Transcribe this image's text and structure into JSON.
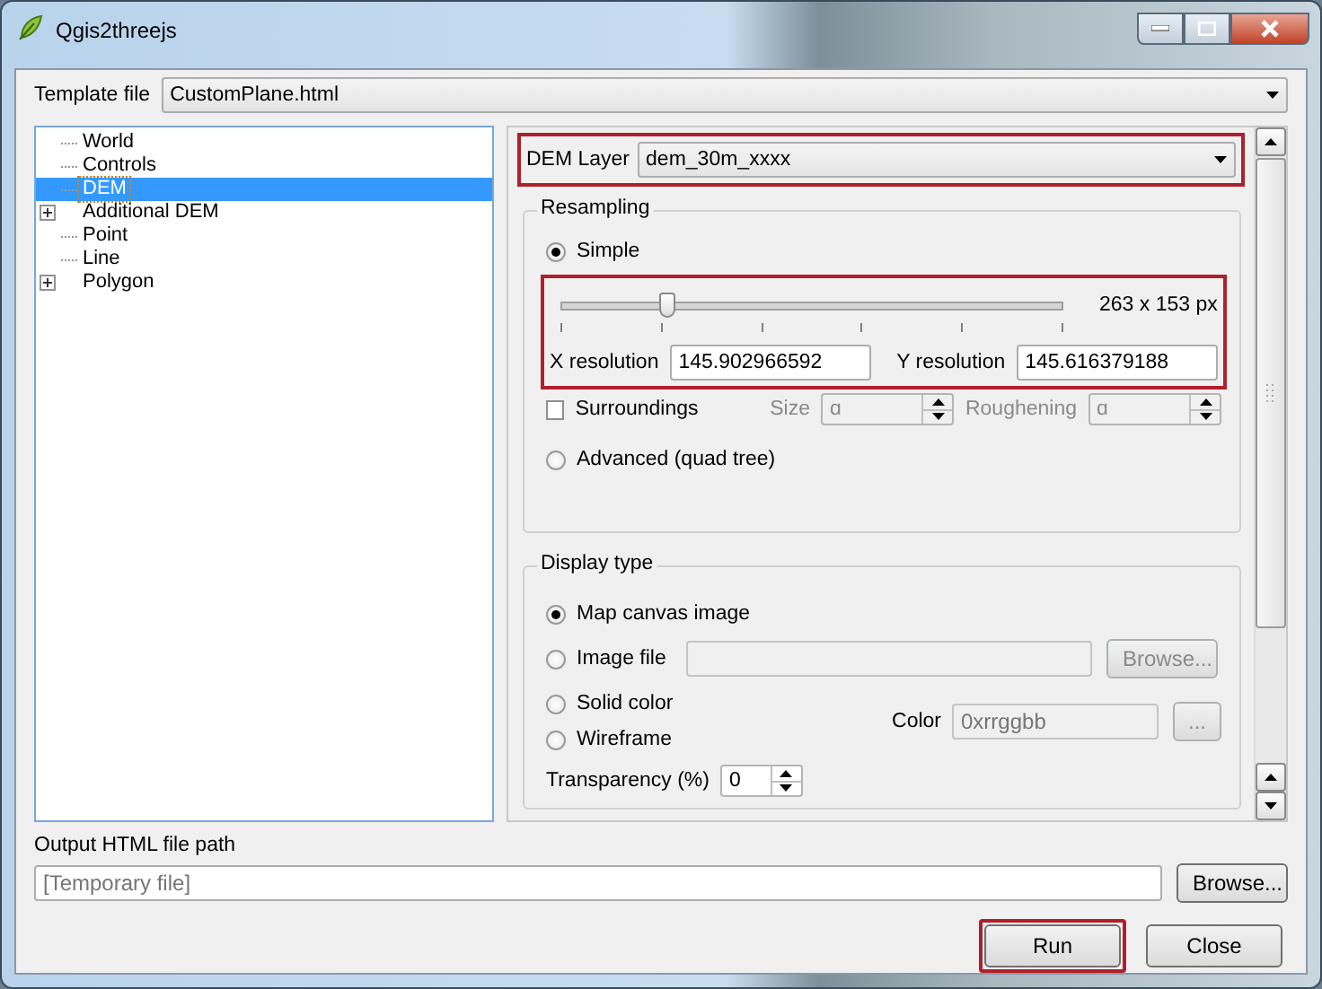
{
  "window": {
    "title": "Qgis2threejs"
  },
  "template": {
    "label": "Template file",
    "value": "CustomPlane.html"
  },
  "tree": [
    {
      "label": "World",
      "kind": "leaf",
      "selected": false
    },
    {
      "label": "Controls",
      "kind": "leaf",
      "selected": false
    },
    {
      "label": "DEM",
      "kind": "leaf",
      "selected": true
    },
    {
      "label": "Additional DEM",
      "kind": "group",
      "expanded": false,
      "selected": false
    },
    {
      "label": "Point",
      "kind": "leaf",
      "selected": false
    },
    {
      "label": "Line",
      "kind": "leaf",
      "selected": false
    },
    {
      "label": "Polygon",
      "kind": "group",
      "expanded": false,
      "selected": false
    }
  ],
  "dem_layer": {
    "label": "DEM Layer",
    "value": "dem_30m_xxxx",
    "highlighted": true
  },
  "resampling": {
    "title": "Resampling",
    "options": [
      {
        "label": "Simple",
        "selected": true
      },
      {
        "label": "Advanced (quad tree)",
        "selected": false
      }
    ],
    "slider": {
      "level": 0.215,
      "reading": "263 x 153 px"
    },
    "resolution_highlighted": true,
    "x_resolution": {
      "label": "X resolution",
      "value": "145.902966592"
    },
    "y_resolution": {
      "label": "Y resolution",
      "value": "145.616379188"
    },
    "surroundings": {
      "label": "Surroundings",
      "checked": false
    },
    "size": {
      "label": "Size",
      "value": "ɑ",
      "disabled": true
    },
    "roughening": {
      "label": "Roughening",
      "value": "ɑ",
      "disabled": true
    }
  },
  "display": {
    "title": "Display type",
    "options": [
      {
        "label": "Map canvas image",
        "selected": true
      },
      {
        "label": "Image file",
        "selected": false
      },
      {
        "label": "Solid color",
        "selected": false
      },
      {
        "label": "Wireframe",
        "selected": false
      }
    ],
    "image_browse": {
      "label": "Browse...",
      "disabled": true
    },
    "color": {
      "label": "Color",
      "placeholder": "0xrrggbb",
      "button": "...",
      "disabled": true
    },
    "transparency": {
      "label": "Transparency (%)",
      "value": "0"
    }
  },
  "output": {
    "label": "Output HTML file path",
    "placeholder": "[Temporary file]",
    "browse": "Browse..."
  },
  "buttons": [
    {
      "label": "Run",
      "highlighted": true
    },
    {
      "label": "Close",
      "highlighted": false
    }
  ]
}
